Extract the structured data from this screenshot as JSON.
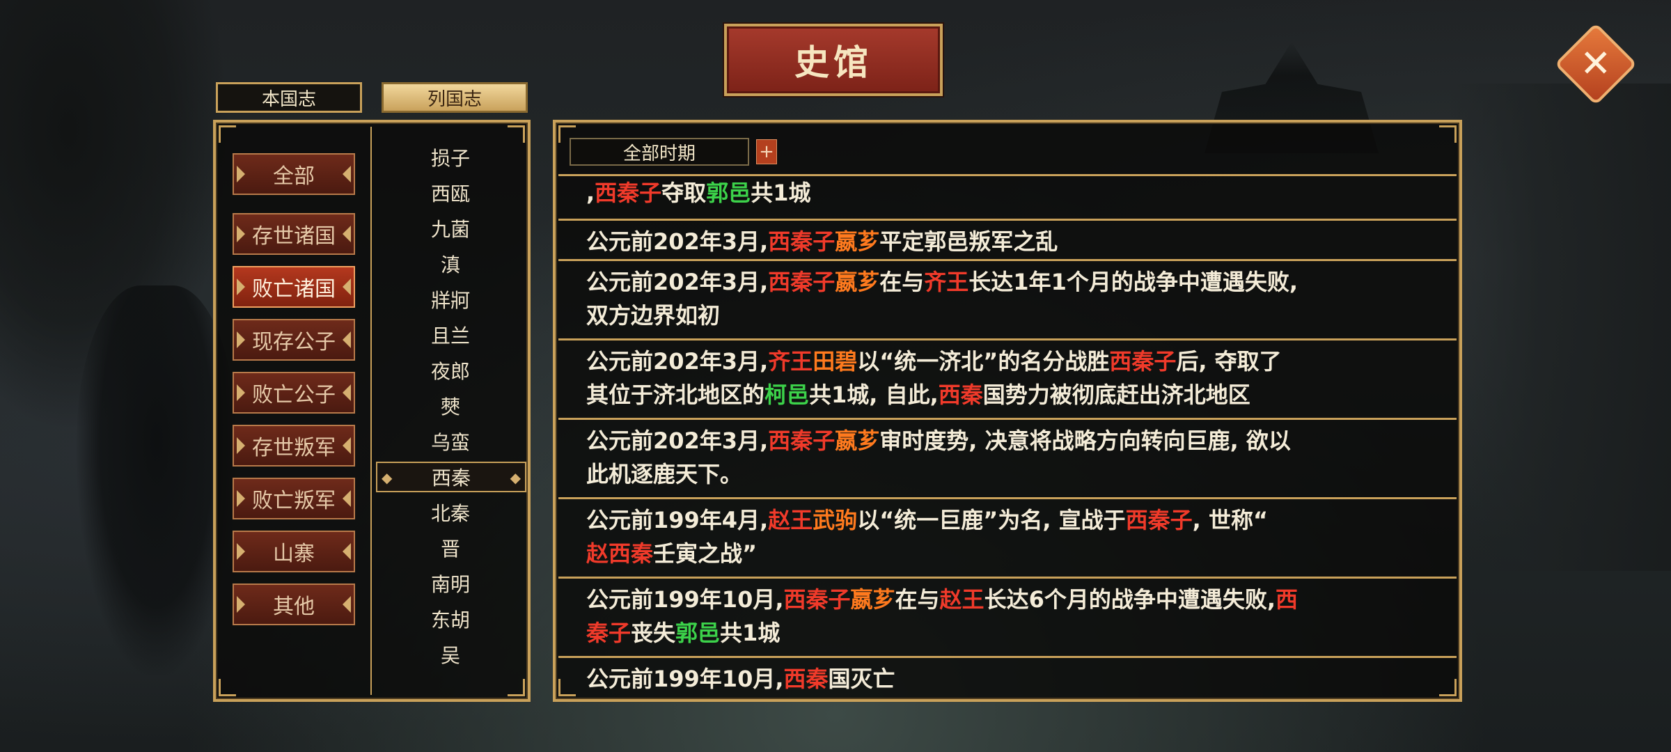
{
  "title": "史馆",
  "close_icon": "✕",
  "tabs": {
    "own": "本国志",
    "all": "列国志"
  },
  "categories": [
    "全部",
    "存世诸国",
    "败亡诸国",
    "现存公子",
    "败亡公子",
    "存世叛军",
    "败亡叛军",
    "山寨",
    "其他"
  ],
  "active_category": "败亡诸国",
  "countries": [
    "损子",
    "西瓯",
    "九菌",
    "滇",
    "牂牁",
    "且兰",
    "夜郎",
    "僰",
    "乌蛮",
    "西秦",
    "北秦",
    "晋",
    "南明",
    "东胡",
    "吴"
  ],
  "selected_country": "西秦",
  "period": {
    "label": "全部时期",
    "plus": "+"
  },
  "colors": {
    "red": "#f03a2a",
    "orange": "#ff7a1e",
    "green": "#3cd24a",
    "gold": "#c9a15a"
  },
  "records": [
    {
      "l1": [
        [
          "",
          ","
        ],
        [
          "r",
          "西秦子"
        ],
        [
          "",
          "夺取"
        ],
        [
          "g",
          "郭邑"
        ],
        [
          "",
          "共1城"
        ]
      ]
    },
    {
      "l1": [
        [
          "",
          "公元前202年3月,"
        ],
        [
          "r",
          "西秦子"
        ],
        [
          "o",
          "嬴芗"
        ],
        [
          "",
          "平定郭邑叛军之乱"
        ]
      ]
    },
    {
      "l1": [
        [
          "",
          "公元前202年3月,"
        ],
        [
          "r",
          "西秦子"
        ],
        [
          "o",
          "嬴芗"
        ],
        [
          "",
          "在与"
        ],
        [
          "r",
          "齐王"
        ],
        [
          "",
          "长达1年1个月的战争中遭遇失败,"
        ]
      ],
      "l2": [
        [
          "",
          "双方边界如初"
        ]
      ]
    },
    {
      "l1": [
        [
          "",
          "公元前202年3月,"
        ],
        [
          "r",
          "齐王"
        ],
        [
          "o",
          "田碧"
        ],
        [
          "",
          "以“统一济北”的名分战胜"
        ],
        [
          "r",
          "西秦子"
        ],
        [
          "",
          "后, 夺取了"
        ]
      ],
      "l2": [
        [
          "",
          "其位于济北地区的"
        ],
        [
          "g",
          "柯邑"
        ],
        [
          "",
          "共1城, 自此,"
        ],
        [
          "r",
          "西秦"
        ],
        [
          "",
          "国势力被彻底赶出济北地区"
        ]
      ]
    },
    {
      "l1": [
        [
          "",
          "公元前202年3月,"
        ],
        [
          "r",
          "西秦子"
        ],
        [
          "o",
          "嬴芗"
        ],
        [
          "",
          "审时度势, 决意将战略方向转向巨鹿, 欲以"
        ]
      ],
      "l2": [
        [
          "",
          "此机逐鹿天下。"
        ]
      ]
    },
    {
      "l1": [
        [
          "",
          "公元前199年4月,"
        ],
        [
          "r",
          "赵王"
        ],
        [
          "o",
          "武驹"
        ],
        [
          "",
          "以“统一巨鹿”为名, 宣战于"
        ],
        [
          "r",
          "西秦子"
        ],
        [
          "",
          ", 世称“"
        ]
      ],
      "l2": [
        [
          "r",
          "赵西秦"
        ],
        [
          "",
          "壬寅之战”"
        ]
      ]
    },
    {
      "l1": [
        [
          "",
          "公元前199年10月,"
        ],
        [
          "r",
          "西秦子"
        ],
        [
          "o",
          "嬴芗"
        ],
        [
          "",
          "在与"
        ],
        [
          "r",
          "赵王"
        ],
        [
          "",
          "长达6个月的战争中遭遇失败,"
        ],
        [
          "r",
          "西"
        ]
      ],
      "l2": [
        [
          "r",
          "秦子"
        ],
        [
          "",
          "丧失"
        ],
        [
          "g",
          "郭邑"
        ],
        [
          "",
          "共1城"
        ]
      ]
    },
    {
      "l1": [
        [
          "",
          "公元前199年10月,"
        ],
        [
          "r",
          "西秦"
        ],
        [
          "",
          "国灭亡"
        ]
      ]
    }
  ]
}
